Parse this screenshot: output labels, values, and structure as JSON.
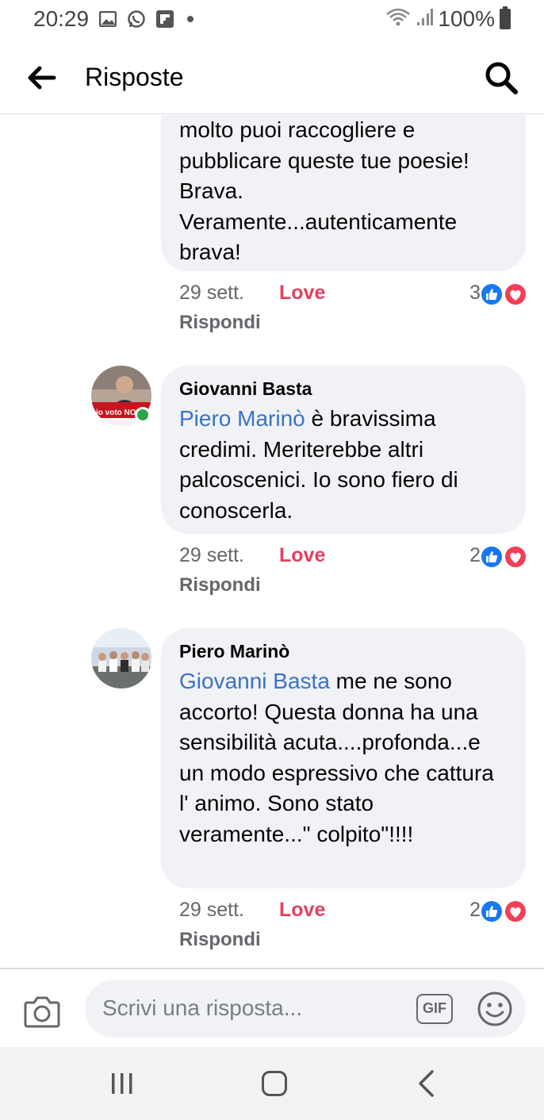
{
  "status_bar": {
    "time": "20:29",
    "battery": "100%"
  },
  "header": {
    "title": "Risposte"
  },
  "comments": [
    {
      "text": "molto puoi raccogliere e pubblicare queste tue poesie! Brava. Veramente...autenticamente brava!",
      "date": "29 sett.",
      "love": "Love",
      "reaction_count": "3",
      "reply": "Rispondi"
    },
    {
      "author": "Giovanni Basta",
      "mention": "Piero Marinò",
      "text": " è bravissima credimi. Meriterebbe altri palcoscenici. Io sono fiero di conoscerla.",
      "date": "29 sett.",
      "love": "Love",
      "reaction_count": "2",
      "reply": "Rispondi",
      "avatar_text": "io voto NO"
    },
    {
      "author": "Piero Marinò",
      "mention": "Giovanni Basta",
      "text": " me ne sono accorto! Questa donna ha una sensibilità acuta....profonda...e un modo espressivo che cattura l' animo. Sono stato veramente...\" colpito\"!!!!",
      "date": "29 sett.",
      "love": "Love",
      "reaction_count": "2",
      "reply": "Rispondi"
    }
  ],
  "composer": {
    "placeholder": "Scrivi una risposta...",
    "gif_label": "GIF"
  },
  "icons": {
    "back": "arrow-left-icon",
    "search": "search-icon",
    "like": "like-icon",
    "heart": "heart-icon",
    "camera": "camera-icon",
    "emoji": "emoji-icon"
  },
  "colors": {
    "mention": "#3a72c8",
    "love": "#e4405f",
    "like": "#1877f2",
    "online": "#31a24c"
  }
}
